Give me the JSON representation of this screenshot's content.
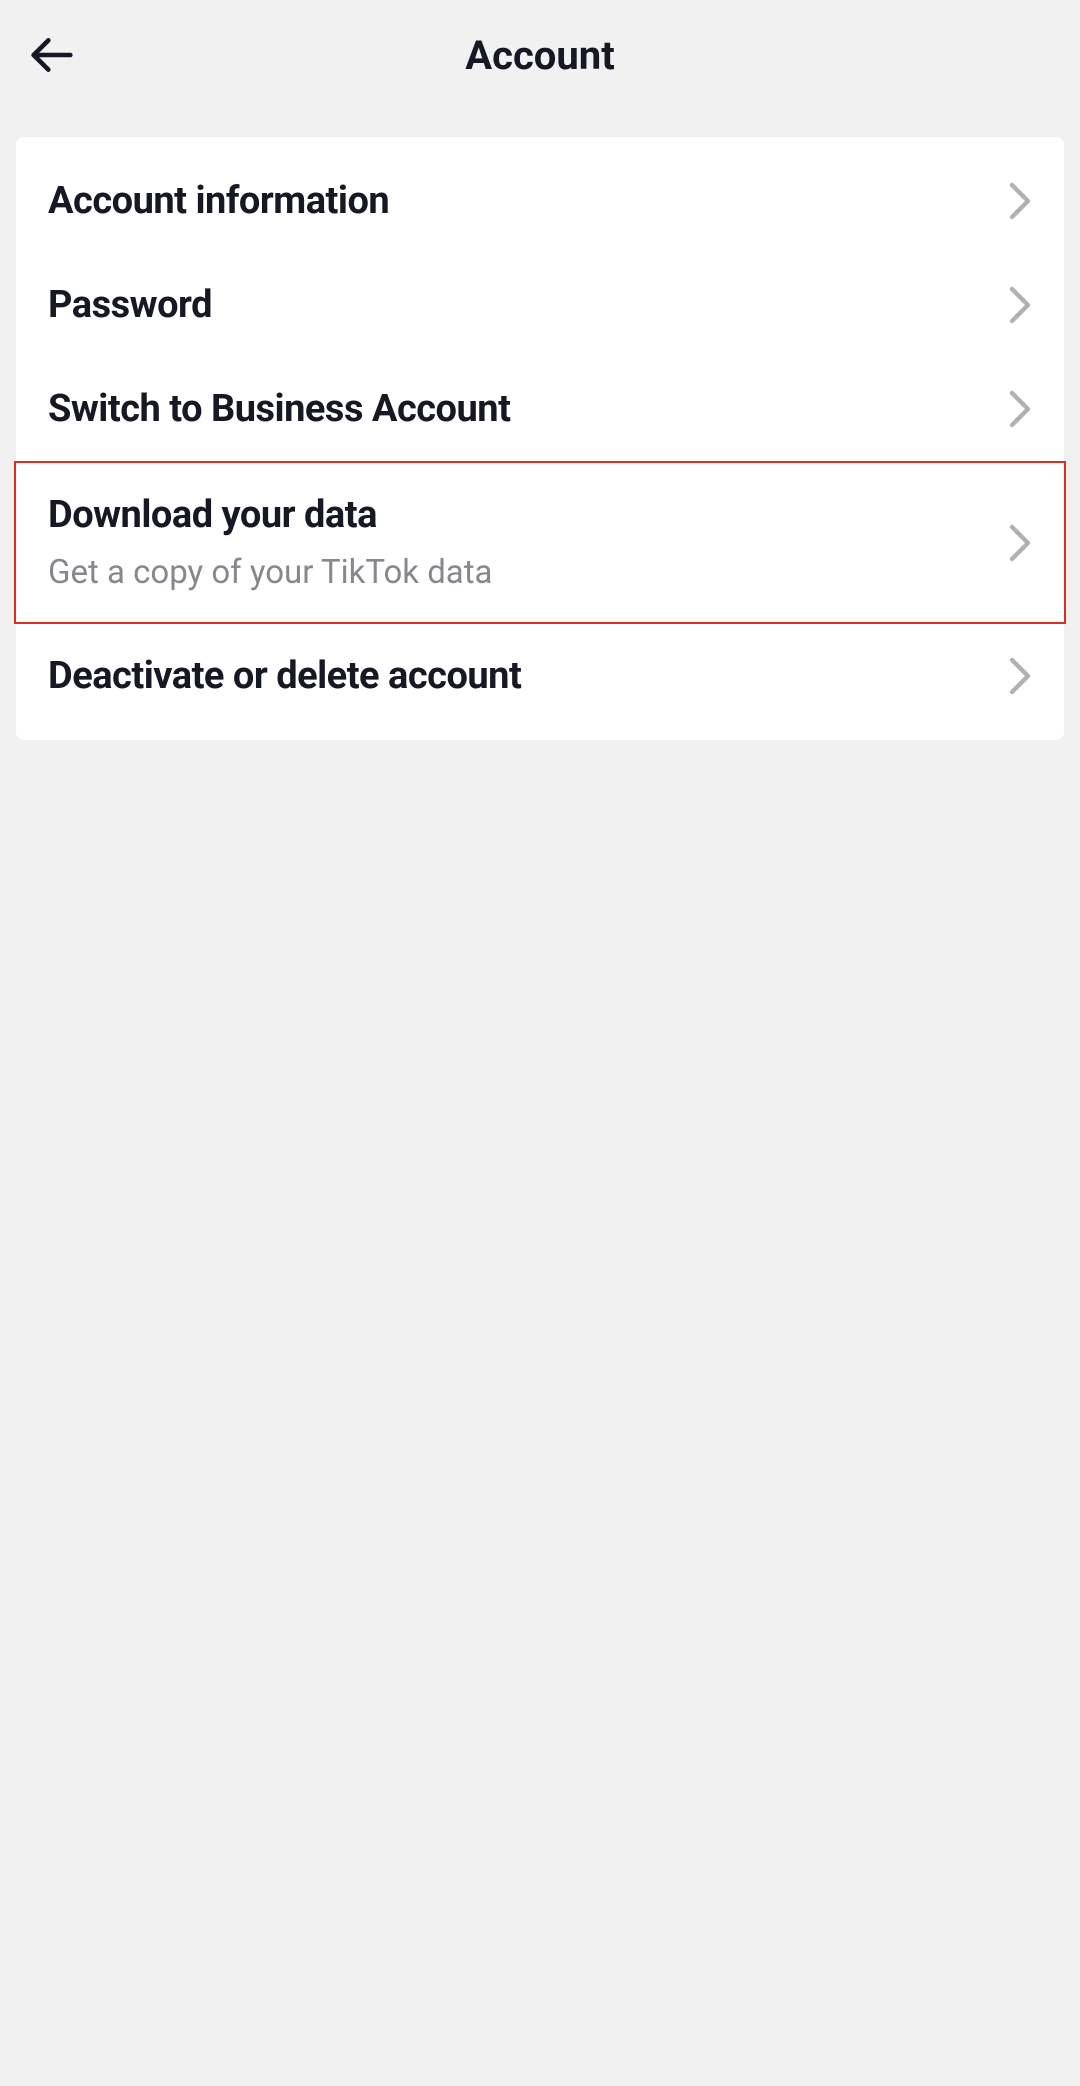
{
  "header": {
    "title": "Account"
  },
  "menu": {
    "items": [
      {
        "title": "Account information",
        "subtitle": null,
        "highlighted": false
      },
      {
        "title": "Password",
        "subtitle": null,
        "highlighted": false
      },
      {
        "title": "Switch to Business Account",
        "subtitle": null,
        "highlighted": false
      },
      {
        "title": "Download your data",
        "subtitle": "Get a copy of your TikTok data",
        "highlighted": true
      },
      {
        "title": "Deactivate or delete account",
        "subtitle": null,
        "highlighted": false
      }
    ]
  }
}
